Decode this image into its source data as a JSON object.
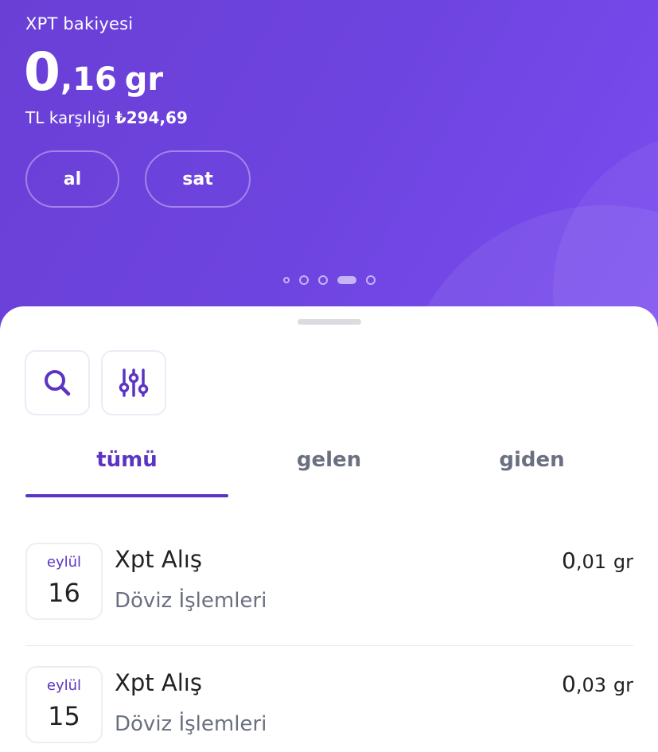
{
  "header": {
    "balance_label": "XPT bakiyesi",
    "balance_int": "0",
    "balance_dec": ",16",
    "balance_unit": "gr",
    "tl_label": "TL karşılığı",
    "tl_value": "₺294,69",
    "buy_label": "al",
    "sell_label": "sat",
    "pager": {
      "count": 5,
      "active_index": 3
    }
  },
  "toolbar": {
    "search_icon": "search-icon",
    "filter_icon": "sliders-icon"
  },
  "tabs": [
    {
      "label": "tümü",
      "active": true
    },
    {
      "label": "gelen",
      "active": false
    },
    {
      "label": "giden",
      "active": false
    }
  ],
  "transactions": [
    {
      "month": "eylül",
      "day": "16",
      "title": "Xpt Alış",
      "subtitle": "Döviz İşlemleri",
      "amount_int": "0",
      "amount_dec": ",01",
      "amount_unit": "gr"
    },
    {
      "month": "eylül",
      "day": "15",
      "title": "Xpt Alış",
      "subtitle": "Döviz İşlemleri",
      "amount_int": "0",
      "amount_dec": ",03",
      "amount_unit": "gr"
    }
  ],
  "colors": {
    "accent": "#5b34c4",
    "hero_bg": "#6e44e0",
    "muted_text": "#6b7080"
  }
}
